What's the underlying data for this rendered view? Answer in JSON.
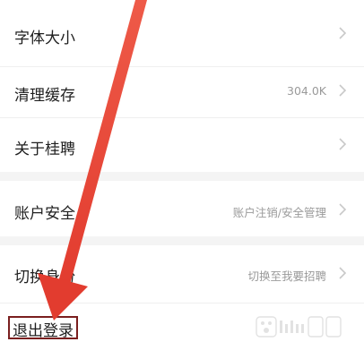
{
  "settings": {
    "items": [
      {
        "label": "字体大小",
        "value": ""
      },
      {
        "label": "清理缓存",
        "value": "304.0K"
      },
      {
        "label": "关于桂聘",
        "value": ""
      },
      {
        "label": "账户安全",
        "value": "账户注销/安全管理"
      },
      {
        "label": "切换身份",
        "value": "切换至我要招聘"
      }
    ],
    "logout_label": "退出登录"
  },
  "icons": {
    "chevron": "chevron-right-icon",
    "annotation": "red-arrow-annotation"
  },
  "colors": {
    "arrow": "#e8473b",
    "highlight_box": "#7a1f1f",
    "divider": "#f4f4f4",
    "value_text": "#9a9a9a",
    "chevron": "#c8c8c8"
  }
}
